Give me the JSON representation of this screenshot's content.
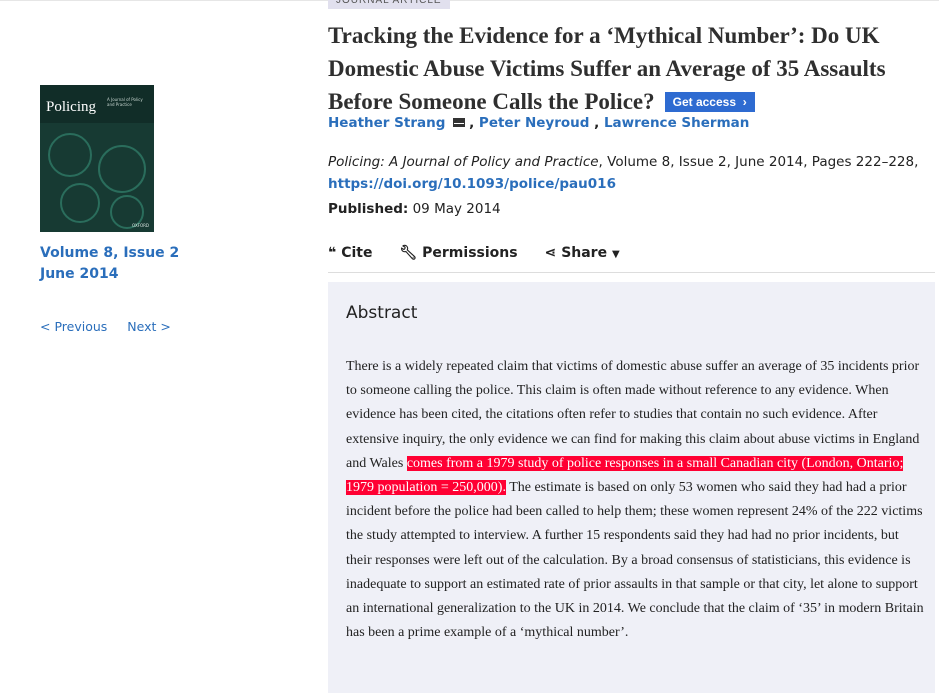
{
  "article_type": "JOURNAL ARTICLE",
  "sidebar": {
    "cover": {
      "title": "Policing",
      "subtitle": "A Journal of Policy and Practice",
      "publisher": "OXFORD"
    },
    "issue_line1": "Volume 8, Issue 2",
    "issue_line2": "June 2014",
    "previous": "< Previous",
    "next": "Next >"
  },
  "article": {
    "title": "Tracking the Evidence for a ‘Mythical Number’: Do UK Domestic Abuse Victims Suffer an Average of 35 Assaults Before Someone Calls the Police?",
    "get_access": "Get access",
    "authors": [
      "Heather Strang",
      "Peter Neyroud",
      "Lawrence Sherman"
    ],
    "journal": "Policing: A Journal of Policy and Practice",
    "citation_rest": ", Volume 8, Issue 2, June 2014, Pages 222–228,",
    "doi": "https://doi.org/10.1093/police/pau016",
    "published_label": "Published:",
    "published_date": "09 May 2014"
  },
  "tools": {
    "cite": "Cite",
    "permissions": "Permissions",
    "share": "Share"
  },
  "abstract": {
    "heading": "Abstract",
    "text_before": "There is a widely repeated claim that victims of domestic abuse suffer an average of 35 incidents prior to someone calling the police. This claim is often made without reference to any evidence. When evidence has been cited, the citations often refer to studies that contain no such evidence. After extensive inquiry, the only evidence we can find for making this claim about abuse victims in England and Wales ",
    "text_highlight": "comes from a 1979 study of police responses in a small Canadian city (London, Ontario; 1979 population = 250,000).",
    "text_after": " The estimate is based on only 53 women who said they had had a prior incident before the police had been called to help them; these women represent 24% of the 222 victims the study attempted to interview. A further 15 respondents said they had had no prior incidents, but their responses were left out of the calculation. By a broad consensus of statisticians, this evidence is inadequate to support an estimated rate of prior assaults in that sample or that city, let alone to support an international generalization to the UK in 2014. We conclude that the claim of ‘35’ in modern Britain has been a prime example of a ‘mythical number’."
  },
  "colors": {
    "link": "#2a6ebb",
    "button": "#2e6bd1",
    "highlight": "#ff0033",
    "abstract_bg": "#eff0f7"
  }
}
